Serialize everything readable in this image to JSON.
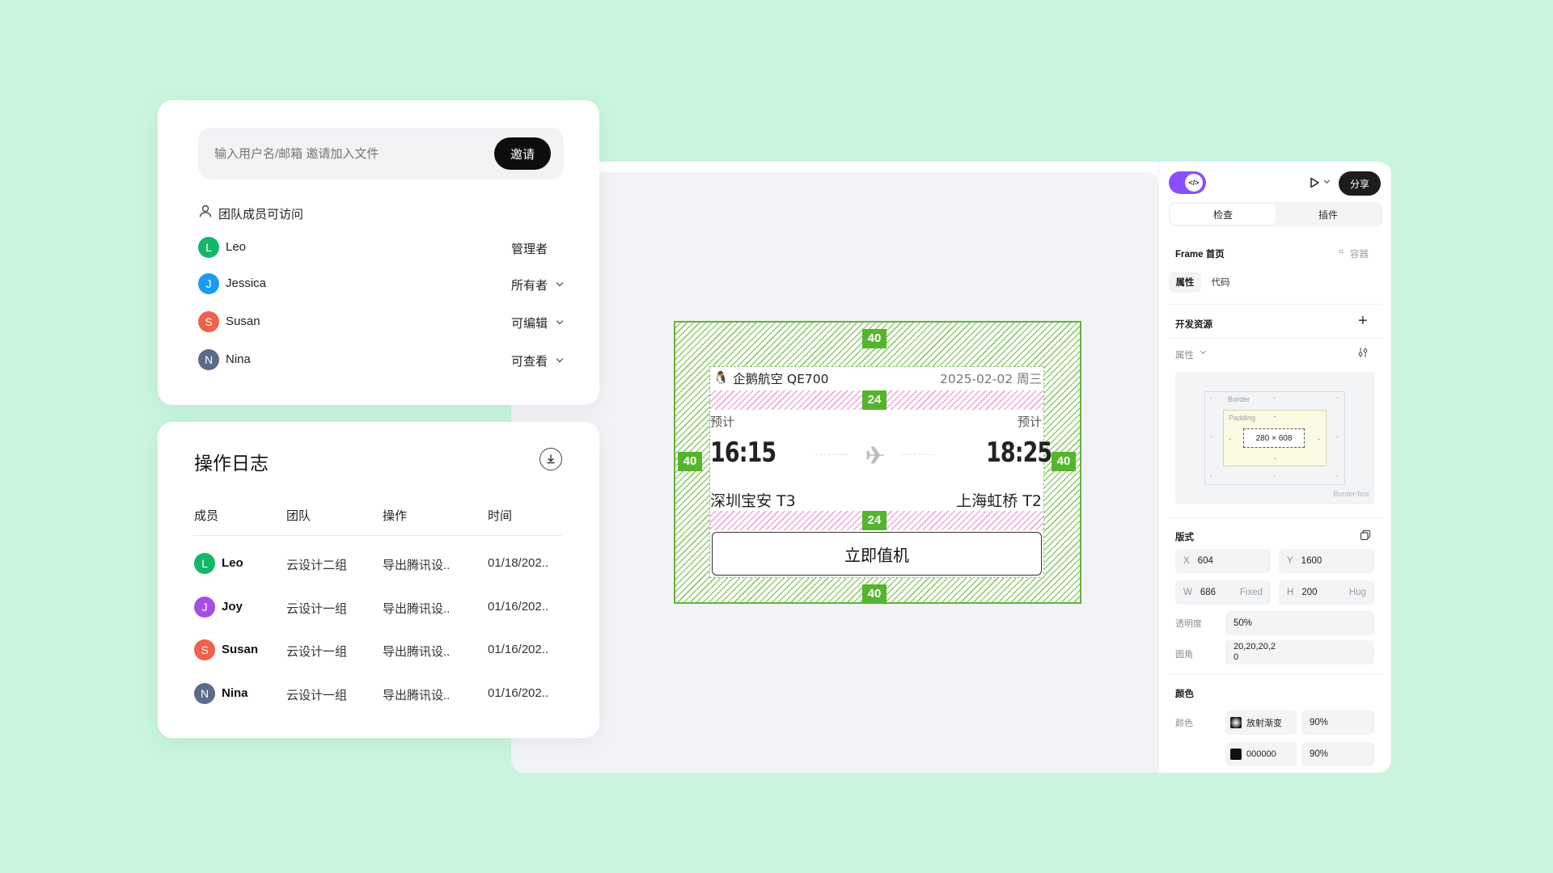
{
  "share": {
    "input_placeholder": "输入用户名/邮箱 邀请加入文件",
    "invite_label": "邀请",
    "access_label": "团队成员可访问",
    "members": [
      {
        "initial": "L",
        "name": "Leo",
        "role": "管理者",
        "color": "#12b76a",
        "has_dropdown": false
      },
      {
        "initial": "J",
        "name": "Jessica",
        "role": "所有者",
        "color": "#1d9bf0",
        "has_dropdown": true
      },
      {
        "initial": "S",
        "name": "Susan",
        "role": "可编辑",
        "color": "#f0604a",
        "has_dropdown": true
      },
      {
        "initial": "N",
        "name": "Nina",
        "role": "可查看",
        "color": "#5b6b8a",
        "has_dropdown": true
      }
    ]
  },
  "log": {
    "title": "操作日志",
    "download_icon": "download-icon",
    "columns": [
      "成员",
      "团队",
      "操作",
      "时间"
    ],
    "rows": [
      {
        "initial": "L",
        "name": "Leo",
        "team": "云设计二组",
        "action": "导出腾讯设..",
        "time": "01/18/202..",
        "color": "#12b76a"
      },
      {
        "initial": "J",
        "name": "Joy",
        "team": "云设计一组",
        "action": "导出腾讯设..",
        "time": "01/16/202..",
        "color": "#a64de3"
      },
      {
        "initial": "S",
        "name": "Susan",
        "team": "云设计一组",
        "action": "导出腾讯设..",
        "time": "01/16/202..",
        "color": "#f0604a"
      },
      {
        "initial": "N",
        "name": "Nina",
        "team": "云设计一组",
        "action": "导出腾讯设..",
        "time": "01/16/202..",
        "color": "#5b6b8a"
      }
    ]
  },
  "flight": {
    "airline": "企鹅航空 QE700",
    "date": "2025-02-02 周三",
    "label_left": "预计",
    "label_right": "预计",
    "depart_time": "16:15",
    "arrive_time": "18:25",
    "from": "深圳宝安 T3",
    "to": "上海虹桥 T2",
    "checkin": "立即值机",
    "padding_outer": "40",
    "padding_gap": "24"
  },
  "inspector": {
    "tab_inspect": "检查",
    "tab_plugin": "插件",
    "share_label": "分享",
    "frame_label": "Frame 首页",
    "container_label": "容器",
    "sub_tab_props": "属性",
    "sub_tab_code": "代码",
    "dev_resources": "开发资源",
    "props_dropdown": "属性",
    "box_border": "Border",
    "box_padding": "Padding",
    "box_size": "280 × 608",
    "box_dash": "-",
    "box_mode": "Border-box",
    "layout_title": "版式",
    "x_label": "X",
    "x_value": "604",
    "y_label": "Y",
    "y_value": "1600",
    "w_label": "W",
    "w_value": "686",
    "w_mode": "Fixed",
    "h_label": "H",
    "h_value": "200",
    "h_mode": "Hug",
    "opacity_label": "透明度",
    "opacity_value": "50%",
    "radius_label": "圆角",
    "radius_value": "20,20,20,2\n0",
    "color_section": "颜色",
    "color_label": "颜色",
    "fill1_name": "放射渐变",
    "fill1_opacity": "90%",
    "fill2_name": "000000",
    "fill2_opacity": "90%",
    "toggle_color": "#8a4dff"
  }
}
